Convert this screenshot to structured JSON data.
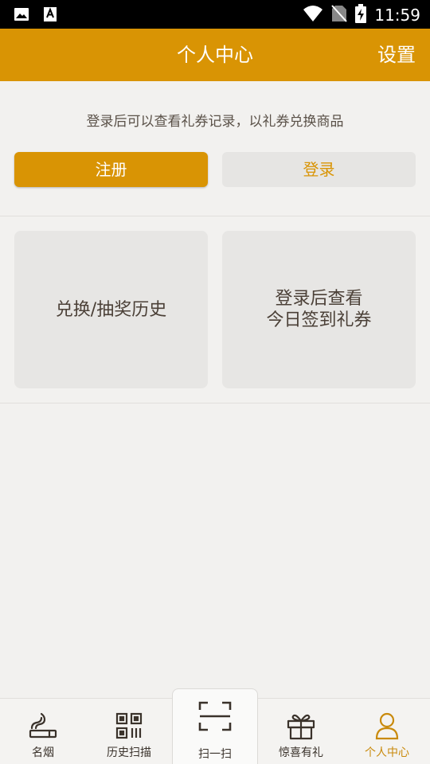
{
  "status_bar": {
    "time": "11:59",
    "icons": [
      "image-icon",
      "a-icon",
      "wifi-icon",
      "no-sim-icon",
      "battery-charging-icon"
    ]
  },
  "app_bar": {
    "title": "个人中心",
    "action_label": "设置"
  },
  "notice": "登录后可以查看礼券记录，以礼券兑换商品",
  "buttons": {
    "register_label": "注册",
    "login_label": "登录"
  },
  "cards": {
    "history_label": "兑换/抽奖历史",
    "checkin_line1": "登录后查看",
    "checkin_line2": "今日签到礼券"
  },
  "tabs": [
    {
      "label": "名烟",
      "icon": "cigarette-icon"
    },
    {
      "label": "历史扫描",
      "icon": "qr-code-icon"
    },
    {
      "label": "扫一扫",
      "icon": "scan-frame-icon"
    },
    {
      "label": "惊喜有礼",
      "icon": "gift-icon"
    },
    {
      "label": "个人中心",
      "icon": "person-icon"
    }
  ],
  "colors": {
    "accent": "#d99404",
    "background": "#f2f1ef",
    "card": "#e7e6e4"
  }
}
